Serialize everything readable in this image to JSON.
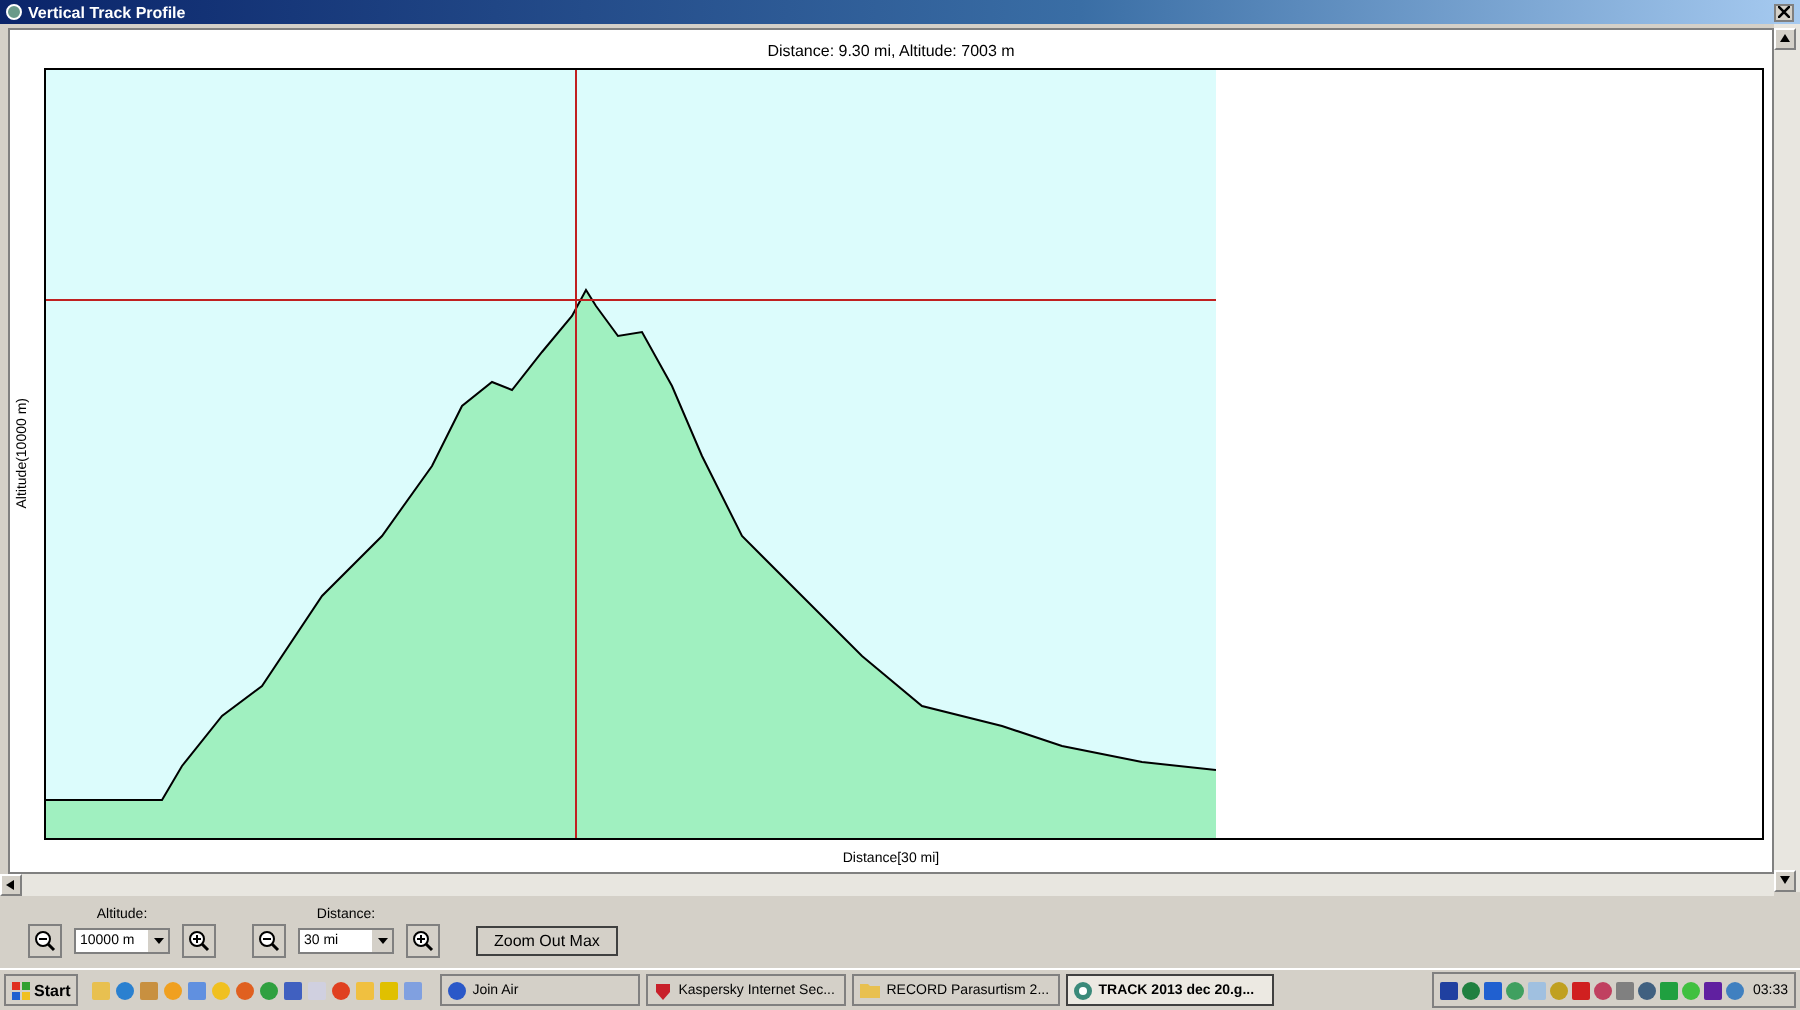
{
  "window": {
    "title": "Vertical Track Profile"
  },
  "chart": {
    "readout": "Distance: 9.30 mi, Altitude: 7003 m",
    "y_label": "Altitude(10000 m)",
    "x_label": "Distance[30 mi]"
  },
  "controls": [
    {
      "label": "Altitude:",
      "value": "10000 m"
    },
    {
      "label": "Distance:",
      "value": "30 mi"
    }
  ],
  "zoom_out_button": "Zoom Out Max",
  "taskbar": {
    "start": "Start",
    "tasks": [
      {
        "label": "Join Air",
        "kind": "globe",
        "selected": false
      },
      {
        "label": "Kaspersky Internet Sec...",
        "kind": "shield",
        "selected": false
      },
      {
        "label": "RECORD Parasurtism 2...",
        "kind": "folder",
        "selected": false
      },
      {
        "label": "TRACK 2013 dec 20.g...",
        "kind": "app",
        "selected": true
      }
    ],
    "clock": "03:33"
  }
}
